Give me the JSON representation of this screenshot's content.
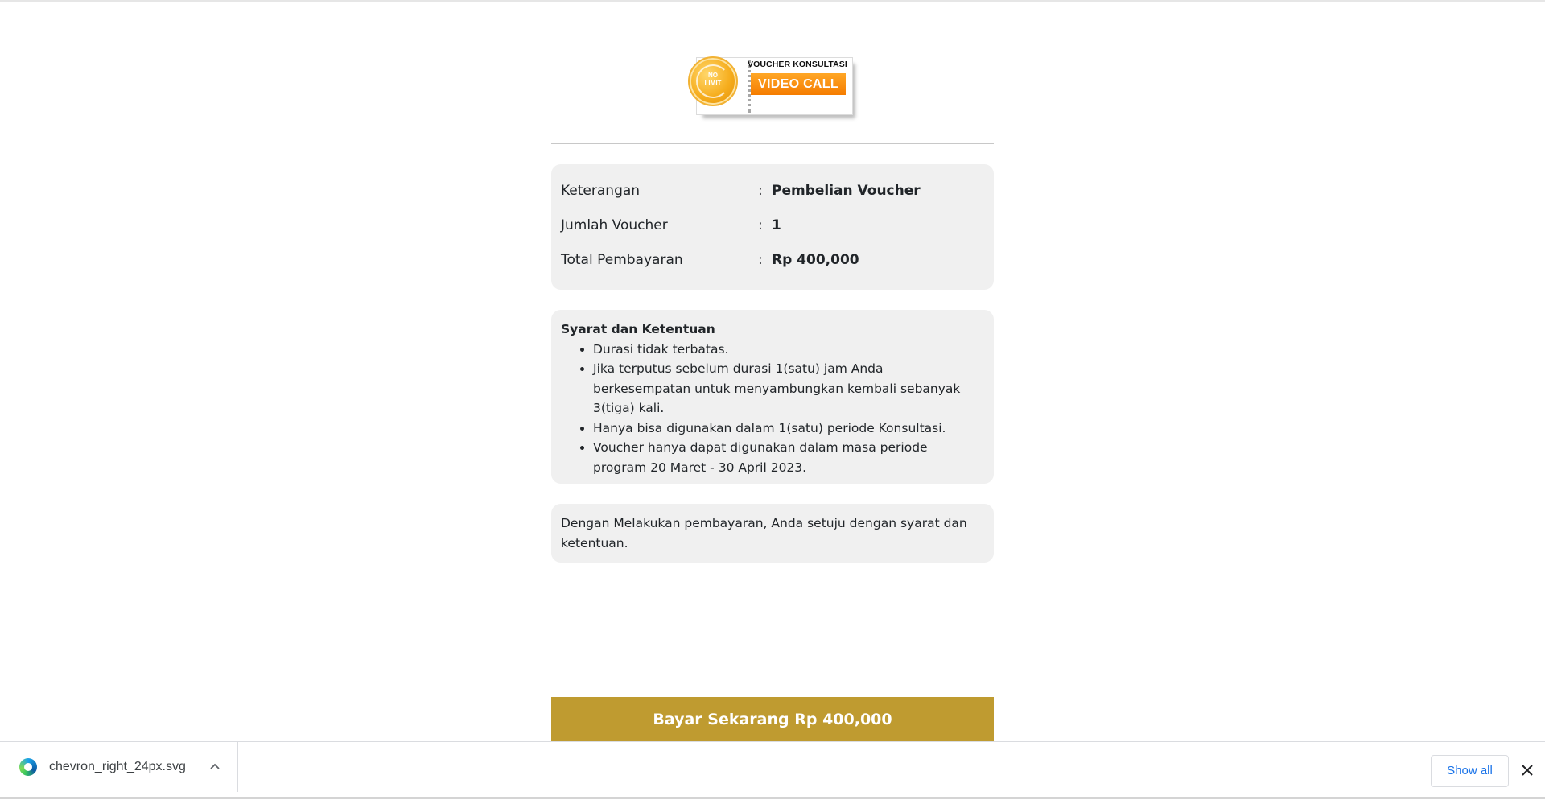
{
  "logo": {
    "badge_line1": "NO",
    "badge_line2": "LIMIT",
    "title": "VOUCHER KONSULTASI",
    "pill": "VIDEO CALL"
  },
  "summary": {
    "separator": ":",
    "rows": [
      {
        "label": "Keterangan",
        "value": "Pembelian Voucher"
      },
      {
        "label": "Jumlah Voucher",
        "value": "1"
      },
      {
        "label": "Total Pembayaran",
        "value": "Rp 400,000"
      }
    ]
  },
  "terms": {
    "title": "Syarat dan Ketentuan",
    "items": [
      "Durasi tidak terbatas.",
      "Jika terputus sebelum durasi 1(satu) jam Anda berkesempatan untuk menyambungkan kembali sebanyak 3(tiga) kali.",
      "Hanya bisa digunakan dalam 1(satu) periode Konsultasi.",
      "Voucher hanya dapat digunakan dalam masa periode program 20 Maret - 30 April 2023."
    ]
  },
  "agreement": "Dengan Melakukan pembayaran, Anda setuju dengan syarat dan ketentuan.",
  "pay_button": "Bayar Sekarang Rp 400,000",
  "download_shelf": {
    "file_name": "chevron_right_24px.svg",
    "file_icon": "edge-icon",
    "show_all": "Show all"
  },
  "colors": {
    "accent_gold": "#bf9b30",
    "card_bg": "#f0f0f0",
    "pill_orange": "#f57c00",
    "link_blue": "#1a73e8"
  }
}
